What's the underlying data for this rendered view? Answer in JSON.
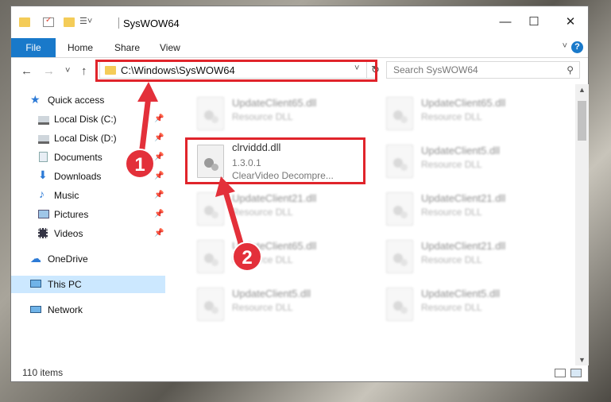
{
  "window": {
    "title": "SysWOW64"
  },
  "ribbon": {
    "tabs": [
      "File",
      "Home",
      "Share",
      "View"
    ],
    "help": "?"
  },
  "nav": {
    "back": "←",
    "forward": "→",
    "recent": "˅",
    "up": "↑"
  },
  "address": {
    "path": "C:\\Windows\\SysWOW64",
    "dropdown": "˅",
    "refresh": "↻"
  },
  "search": {
    "placeholder": "Search SysWOW64"
  },
  "sidebar": {
    "items": [
      {
        "label": "Quick access"
      },
      {
        "label": "Local Disk (C:)"
      },
      {
        "label": "Local Disk (D:)"
      },
      {
        "label": "Documents"
      },
      {
        "label": "Downloads"
      },
      {
        "label": "Music"
      },
      {
        "label": "Pictures"
      },
      {
        "label": "Videos"
      },
      {
        "label": "OneDrive"
      },
      {
        "label": "This PC"
      },
      {
        "label": "Network"
      }
    ]
  },
  "files": [
    {
      "name": "UpdateClient65.dll",
      "type": "Resource DLL"
    },
    {
      "name": "UpdateClient65.dll",
      "type": "Resource DLL"
    },
    {
      "name": "clrviddd.dll",
      "version": "1.3.0.1",
      "description": "ClearVideo Decompre..."
    },
    {
      "name": "UpdateClient5.dll",
      "type": "Resource DLL"
    },
    {
      "name": "UpdateClient21.dll",
      "type": "Resource DLL"
    },
    {
      "name": "UpdateClient21.dll",
      "type": "Resource DLL"
    },
    {
      "name": "UpdateClient65.dll",
      "type": "Resource DLL"
    },
    {
      "name": "UpdateClient21.dll",
      "type": "Resource DLL"
    },
    {
      "name": "UpdateClient5.dll",
      "type": "Resource DLL"
    },
    {
      "name": "UpdateClient5.dll",
      "type": "Resource DLL"
    }
  ],
  "status": {
    "item_count": "110 items"
  },
  "callouts": {
    "one": "1",
    "two": "2"
  },
  "colors": {
    "accent": "#1979ca",
    "highlight": "#e0242b",
    "selected": "#cce8ff"
  }
}
